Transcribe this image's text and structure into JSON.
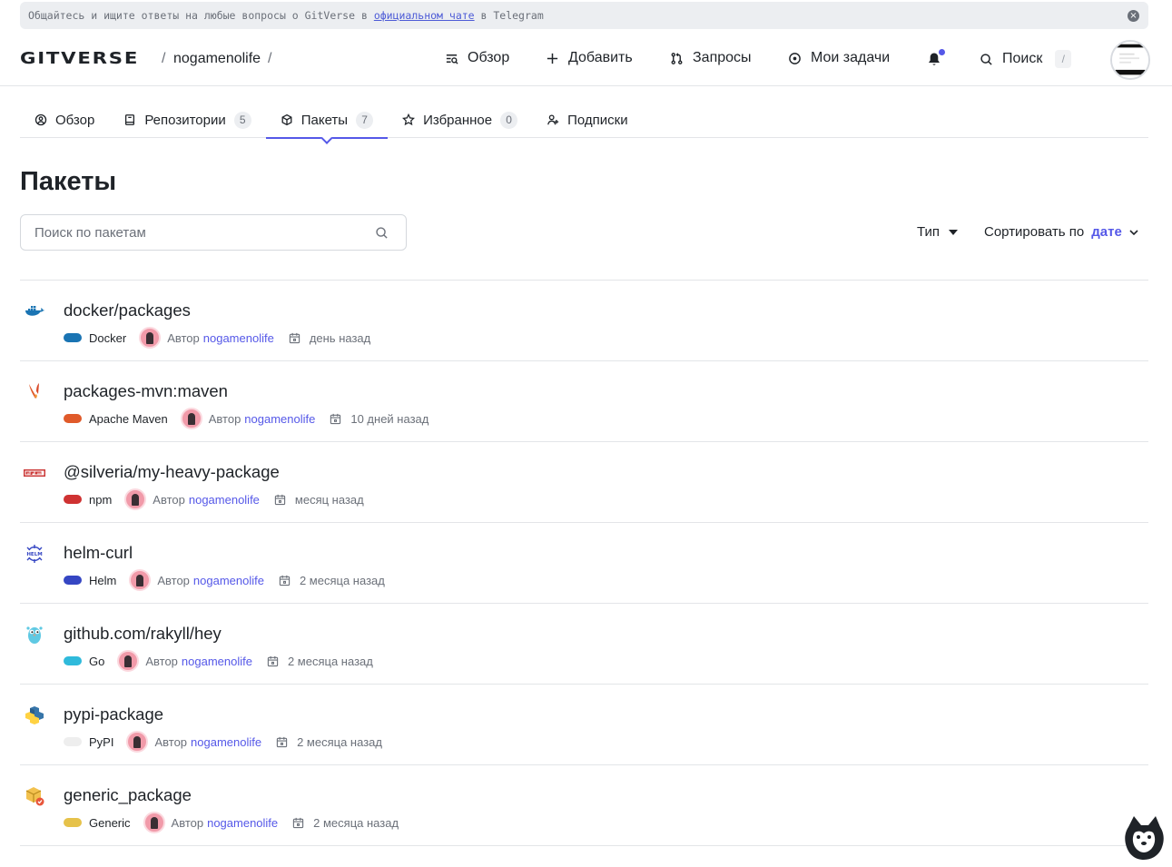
{
  "announcement": {
    "text_before": "Общайтесь и ищите ответы на любые вопросы о GitVerse в ",
    "link": "официальном чате",
    "text_after": " в Telegram"
  },
  "header": {
    "logo": "GITVERSE",
    "breadcrumb_user": "nogamenolife",
    "breadcrumb_sep": "/",
    "nav": {
      "overview": "Обзор",
      "add": "Добавить",
      "requests": "Запросы",
      "tasks": "Мои задачи",
      "search": "Поиск",
      "search_hotkey": "/"
    }
  },
  "tabs": [
    {
      "label": "Обзор",
      "count": null
    },
    {
      "label": "Репозитории",
      "count": "5"
    },
    {
      "label": "Пакеты",
      "count": "7"
    },
    {
      "label": "Избранное",
      "count": "0"
    },
    {
      "label": "Подписки",
      "count": null
    }
  ],
  "page": {
    "title": "Пакеты",
    "search_placeholder": "Поиск по пакетам",
    "type_filter": "Тип",
    "sort_label": "Сортировать по",
    "sort_value": "дате"
  },
  "author_label": "Автор",
  "packages": [
    {
      "name": "docker/packages",
      "type": "Docker",
      "color": "#1a74b3",
      "author": "nogamenolife",
      "date": "день назад"
    },
    {
      "name": "packages-mvn:maven",
      "type": "Apache Maven",
      "color": "#e05a2a",
      "author": "nogamenolife",
      "date": "10 дней назад"
    },
    {
      "name": "@silveria/my-heavy-package",
      "type": "npm",
      "color": "#cf3232",
      "author": "nogamenolife",
      "date": "месяц назад"
    },
    {
      "name": "helm-curl",
      "type": "Helm",
      "color": "#3546c3",
      "author": "nogamenolife",
      "date": "2 месяца назад"
    },
    {
      "name": "github.com/rakyll/hey",
      "type": "Go",
      "color": "#2fbadb",
      "author": "nogamenolife",
      "date": "2 месяца назад"
    },
    {
      "name": "pypi-package",
      "type": "PyPI",
      "color": "#eeeeee",
      "author": "nogamenolife",
      "date": "2 месяца назад"
    },
    {
      "name": "generic_package",
      "type": "Generic",
      "color": "#e6c24a",
      "author": "nogamenolife",
      "date": "2 месяца назад"
    }
  ]
}
